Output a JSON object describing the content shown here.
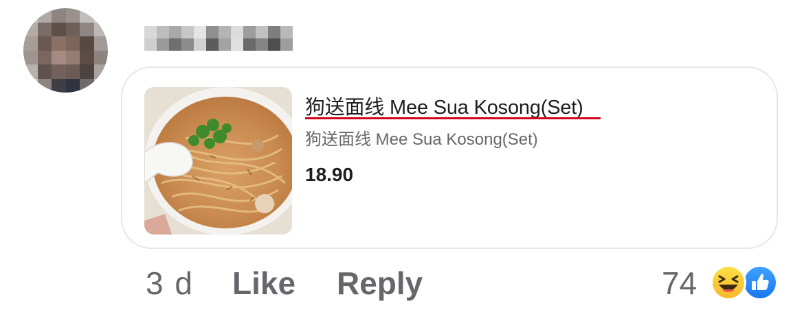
{
  "comment": {
    "time": "3 d",
    "like_label": "Like",
    "reply_label": "Reply",
    "reaction_count": "74"
  },
  "shared_item": {
    "title": "狗送面线 Mee Sua Kosong(Set)",
    "subtitle": "狗送面线 Mee Sua Kosong(Set)",
    "price": "18.90",
    "image_icon": "noodle-bowl-photo"
  },
  "reactions": [
    {
      "name": "haha",
      "icon": "haha-icon"
    },
    {
      "name": "like",
      "icon": "like-icon"
    }
  ],
  "colors": {
    "secondary_text": "#65676b",
    "primary_text": "#1c1e21",
    "underline": "#d0021b",
    "like_blue": "#1877f2",
    "haha_yellow": "#f7b928",
    "card_border": "#e4e6eb"
  }
}
